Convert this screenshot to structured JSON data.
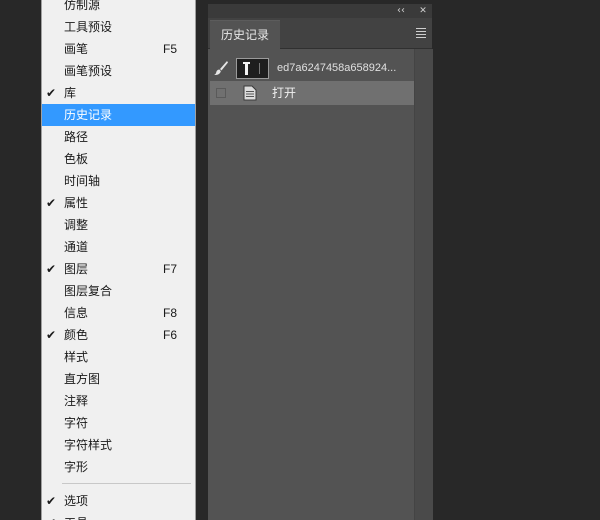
{
  "window_menu": {
    "items": [
      {
        "label": "仿制源",
        "shortcut": "",
        "checked": false,
        "highlighted": false
      },
      {
        "label": "工具预设",
        "shortcut": "",
        "checked": false,
        "highlighted": false
      },
      {
        "label": "画笔",
        "shortcut": "F5",
        "checked": false,
        "highlighted": false
      },
      {
        "label": "画笔预设",
        "shortcut": "",
        "checked": false,
        "highlighted": false
      },
      {
        "label": "库",
        "shortcut": "",
        "checked": true,
        "highlighted": false
      },
      {
        "label": "历史记录",
        "shortcut": "",
        "checked": false,
        "highlighted": true
      },
      {
        "label": "路径",
        "shortcut": "",
        "checked": false,
        "highlighted": false
      },
      {
        "label": "色板",
        "shortcut": "",
        "checked": false,
        "highlighted": false
      },
      {
        "label": "时间轴",
        "shortcut": "",
        "checked": false,
        "highlighted": false
      },
      {
        "label": "属性",
        "shortcut": "",
        "checked": true,
        "highlighted": false
      },
      {
        "label": "调整",
        "shortcut": "",
        "checked": false,
        "highlighted": false
      },
      {
        "label": "通道",
        "shortcut": "",
        "checked": false,
        "highlighted": false
      },
      {
        "label": "图层",
        "shortcut": "F7",
        "checked": true,
        "highlighted": false
      },
      {
        "label": "图层复合",
        "shortcut": "",
        "checked": false,
        "highlighted": false
      },
      {
        "label": "信息",
        "shortcut": "F8",
        "checked": false,
        "highlighted": false
      },
      {
        "label": "颜色",
        "shortcut": "F6",
        "checked": true,
        "highlighted": false
      },
      {
        "label": "样式",
        "shortcut": "",
        "checked": false,
        "highlighted": false
      },
      {
        "label": "直方图",
        "shortcut": "",
        "checked": false,
        "highlighted": false
      },
      {
        "label": "注释",
        "shortcut": "",
        "checked": false,
        "highlighted": false
      },
      {
        "label": "字符",
        "shortcut": "",
        "checked": false,
        "highlighted": false
      },
      {
        "label": "字符样式",
        "shortcut": "",
        "checked": false,
        "highlighted": false
      },
      {
        "label": "字形",
        "shortcut": "",
        "checked": false,
        "highlighted": false
      }
    ],
    "items_after_separator": [
      {
        "label": "选项",
        "shortcut": "",
        "checked": true,
        "highlighted": false
      },
      {
        "label": "工具",
        "shortcut": "",
        "checked": true,
        "highlighted": false
      }
    ],
    "check_glyph": "✔"
  },
  "history_panel": {
    "collapse_glyph": "‹‹",
    "close_glyph": "✕",
    "tab_label": "历史记录",
    "snapshot_label": "ed7a6247458a658924...",
    "history_state_label": "打开",
    "icons": {
      "brush": "brush-icon",
      "document": "document-icon",
      "panel_menu": "hamburger-menu-icon"
    }
  },
  "colors": {
    "highlight": "#3399ff",
    "panel_bg": "#535353",
    "selected_row": "#707070"
  }
}
